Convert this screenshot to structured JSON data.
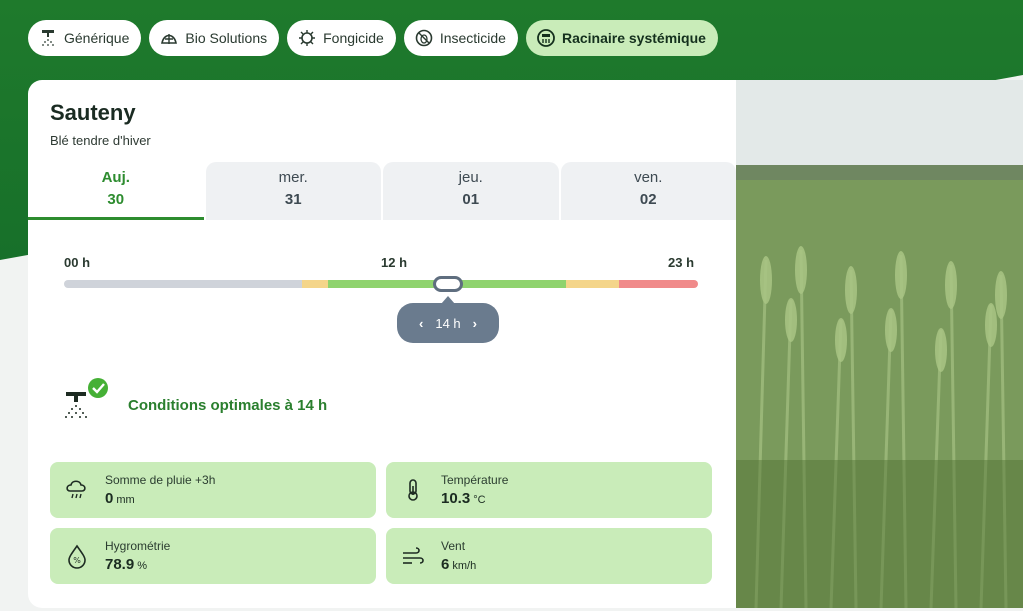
{
  "categories": [
    {
      "label": "Générique",
      "icon": "sprayer-icon",
      "active": false
    },
    {
      "label": "Bio Solutions",
      "icon": "bio-icon",
      "active": false
    },
    {
      "label": "Fongicide",
      "icon": "fungus-icon",
      "active": false
    },
    {
      "label": "Insecticide",
      "icon": "bug-icon",
      "active": false
    },
    {
      "label": "Racinaire systémique",
      "icon": "root-icon",
      "active": true
    }
  ],
  "location": {
    "name": "Sauteny",
    "crop": "Blé tendre d'hiver"
  },
  "days": [
    {
      "name": "Auj.",
      "num": "30",
      "active": true
    },
    {
      "name": "mer.",
      "num": "31",
      "active": false
    },
    {
      "name": "jeu.",
      "num": "01",
      "active": false
    },
    {
      "name": "ven.",
      "num": "02",
      "active": false
    }
  ],
  "timeline": {
    "start_label": "00 h",
    "mid_label": "12 h",
    "end_label": "23 h",
    "selected_hour": "14 h",
    "selected_hour_value": 14,
    "prev_arrow": "‹",
    "next_arrow": "›",
    "segments": [
      {
        "from": 0,
        "to": 9,
        "color": "#cfd3da"
      },
      {
        "from": 9,
        "to": 10,
        "color": "#f4d58a"
      },
      {
        "from": 10,
        "to": 19,
        "color": "#8fd36e"
      },
      {
        "from": 19,
        "to": 21,
        "color": "#f4d58a"
      },
      {
        "from": 21,
        "to": 24,
        "color": "#f08a8a"
      }
    ]
  },
  "condition": {
    "text": "Conditions optimales à 14 h",
    "color": "#2a7f2e"
  },
  "metrics": [
    {
      "label": "Somme de pluie +3h",
      "value": "0",
      "unit": "mm",
      "icon": "rain-icon"
    },
    {
      "label": "Température",
      "value": "10.3",
      "unit": "°C",
      "icon": "thermometer-icon"
    },
    {
      "label": "Hygrométrie",
      "value": "78.9",
      "unit": "%",
      "icon": "humidity-icon"
    },
    {
      "label": "Vent",
      "value": "6",
      "unit": "km/h",
      "icon": "wind-icon"
    }
  ],
  "colors": {
    "brand_green": "#1f7a2c",
    "chip_active": "#c9ecb9",
    "metric_bg": "#c9ecb9"
  }
}
